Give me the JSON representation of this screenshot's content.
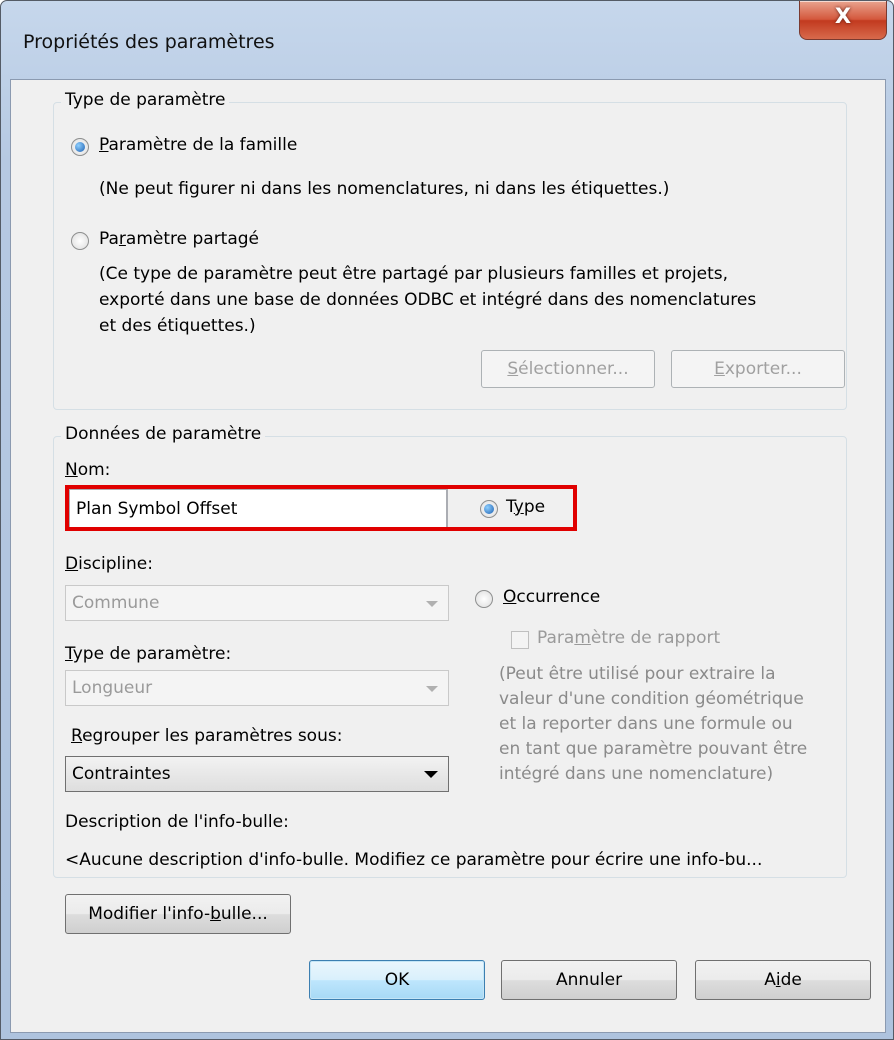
{
  "window": {
    "title": "Propriétés des paramètres",
    "close_label": "X"
  },
  "type_group": {
    "legend": "Type de paramètre",
    "family": {
      "label_key": "P",
      "label_rest": "aramètre de la famille",
      "note": "(Ne peut figurer ni dans les nomenclatures, ni dans les étiquettes.)",
      "checked": true
    },
    "shared": {
      "label_pre": "Pa",
      "label_key": "r",
      "label_rest": "amètre partagé",
      "note_lines": [
        "(Ce type de paramètre peut être partagé par plusieurs familles et projets,",
        "exporté dans une base de données ODBC et intégré dans des nomenclatures",
        "et des étiquettes.)"
      ],
      "checked": false
    },
    "select_button": {
      "key": "S",
      "rest": "électionner..."
    },
    "export_button": {
      "key": "E",
      "rest": "xporter..."
    }
  },
  "data_group": {
    "legend": "Données de paramètre",
    "name_label": {
      "key": "N",
      "rest": "om:"
    },
    "name_value": "Plan Symbol Offset",
    "type_radio": {
      "pre": "T",
      "key": "y",
      "rest": "pe",
      "checked": true
    },
    "discipline_label": {
      "key": "D",
      "rest": "iscipline:"
    },
    "discipline_value": "Commune",
    "occurrence_radio": {
      "key": "O",
      "rest": "ccurrence",
      "checked": false
    },
    "param_type_label": {
      "key": "T",
      "rest": "ype de paramètre:"
    },
    "param_type_value": "Longueur",
    "report_checkbox": {
      "pre": "Para",
      "key": "m",
      "rest": "ètre de rapport",
      "checked": false
    },
    "report_note_lines": [
      "(Peut être utilisé pour extraire la",
      "valeur d'une condition géométrique",
      "et la reporter dans une formule ou",
      "en tant que paramètre pouvant être",
      "intégré dans une nomenclature)"
    ],
    "group_label": {
      "key": "R",
      "rest": "egrouper les paramètres sous:"
    },
    "group_value": "Contraintes",
    "tooltip_label": "Description de l'info-bulle:",
    "tooltip_text": "<Aucune description d'info-bulle. Modifiez ce paramètre pour écrire une info-bu...",
    "edit_tooltip_button": {
      "pre": "Modifier l'info-",
      "key": "b",
      "rest": "ulle..."
    }
  },
  "footer": {
    "ok_label": "OK",
    "cancel_label": "Annuler",
    "help_button": {
      "pre": "A",
      "key": "i",
      "rest": "de"
    }
  }
}
